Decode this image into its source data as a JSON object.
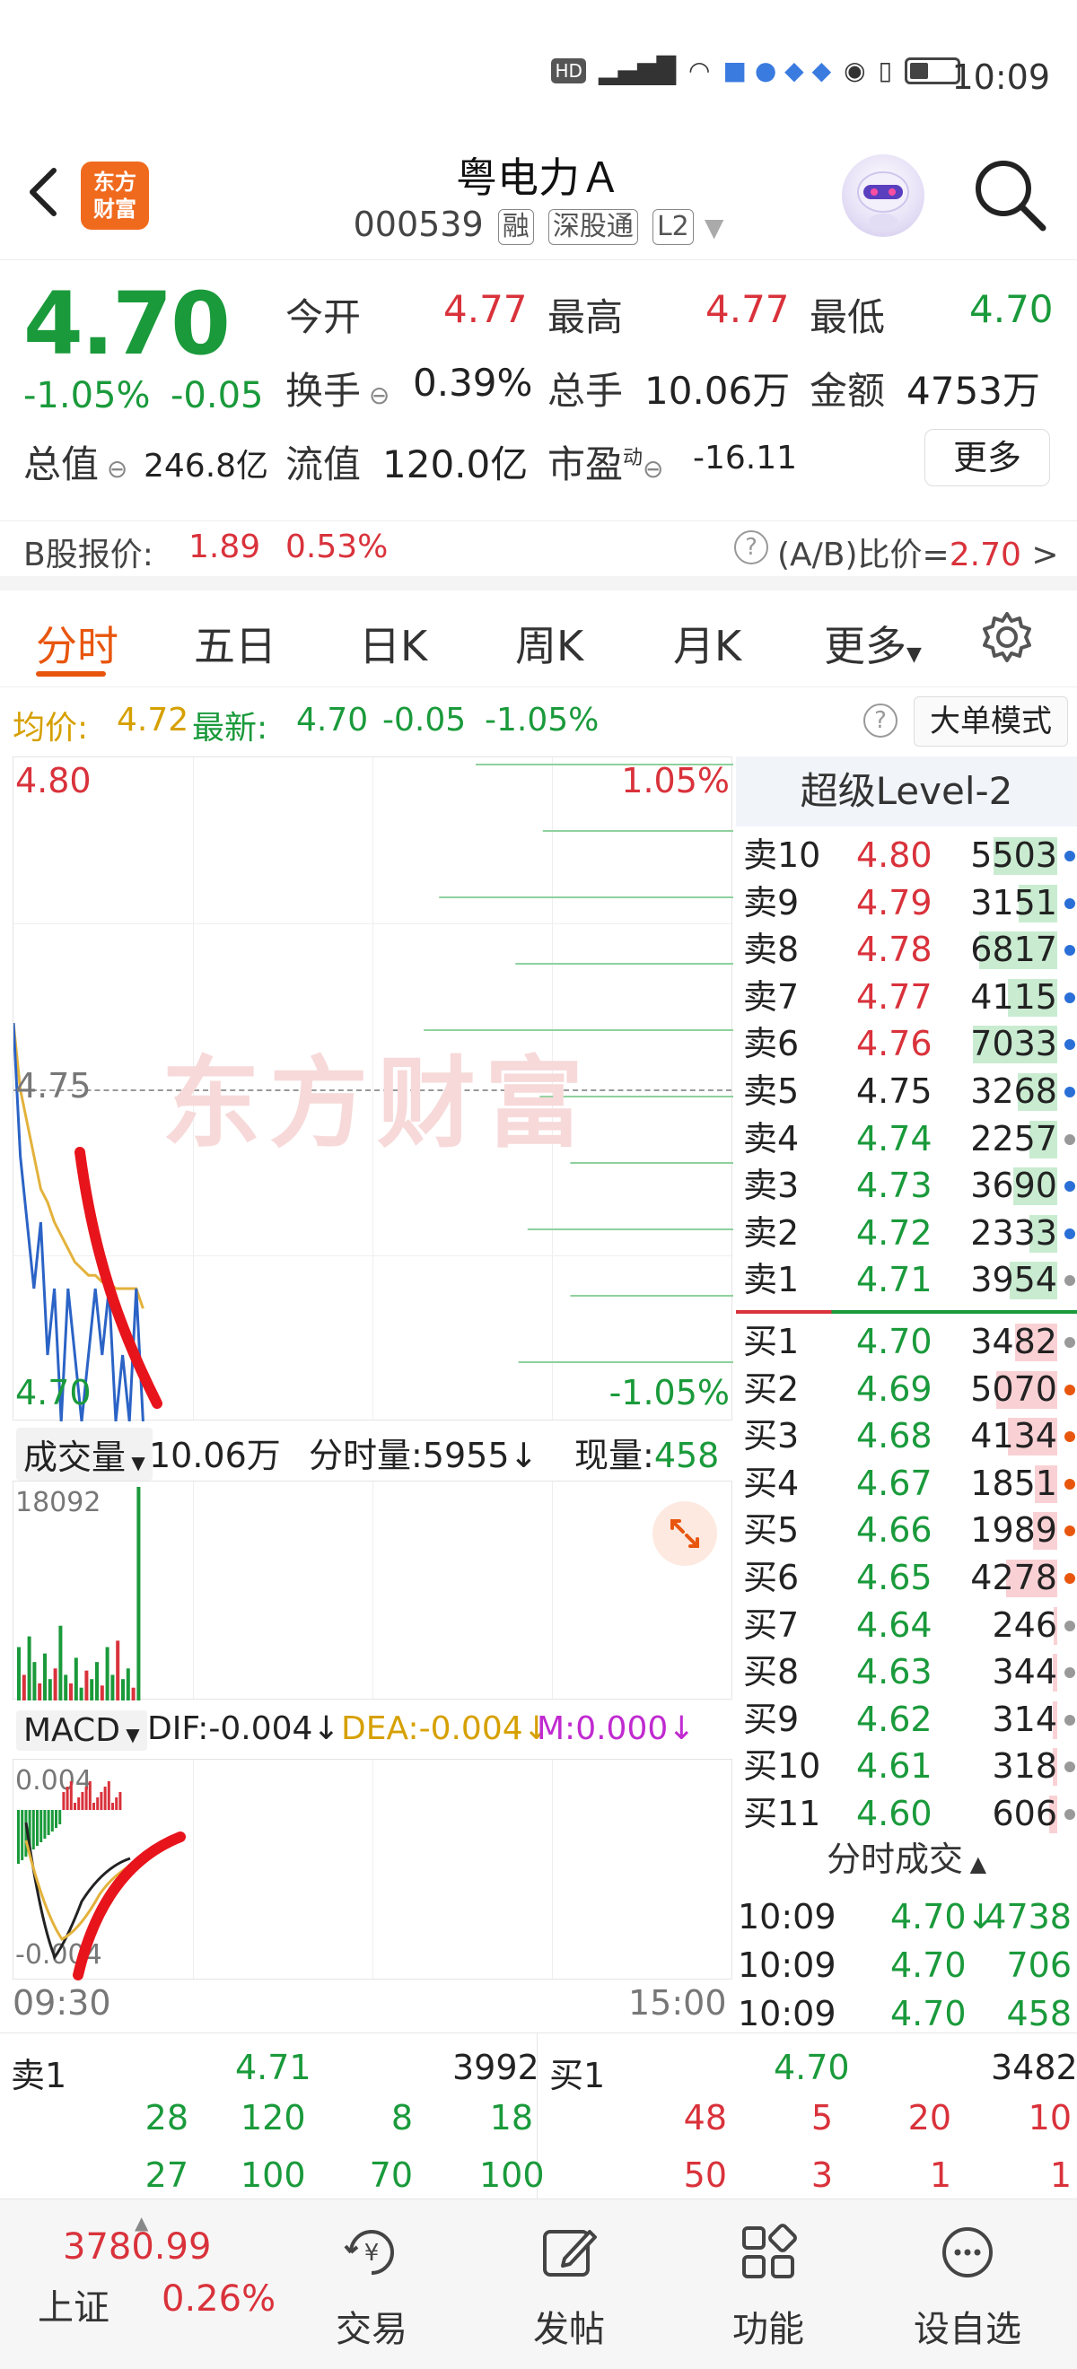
{
  "status": {
    "time": "10:09",
    "icons": [
      "HD",
      "4G",
      "signal",
      "wifi",
      "battery"
    ]
  },
  "header": {
    "logo_text_1": "东方",
    "logo_text_2": "财富",
    "name": "粤电力Ａ",
    "code": "000539",
    "tag_margin": "融",
    "tag_connect": "深股通",
    "tag_level": "L2"
  },
  "quote": {
    "price": "4.70",
    "change_pct": "-1.05%",
    "change": "-0.05",
    "open_label": "今开",
    "open": "4.77",
    "high_label": "最高",
    "high": "4.77",
    "low_label": "最低",
    "low": "4.70",
    "turnover_label": "换手",
    "turnover": "0.39%",
    "volume_label": "总手",
    "volume": "10.06万",
    "amount_label": "金额",
    "amount": "4753万",
    "mktcap_label": "总值",
    "mktcap": "246.8亿",
    "float_label": "流值",
    "float": "120.0亿",
    "pe_label": "市盈",
    "pe_sup": "动",
    "pe": "-16.11",
    "more": "更多"
  },
  "bshare": {
    "label": "B股报价:",
    "price": "1.89",
    "pct": "0.53%",
    "ratio_label": "(A/B)比价=",
    "ratio": "2.70",
    "arrow": ">"
  },
  "tabs": [
    "分时",
    "五日",
    "日K",
    "周K",
    "月K",
    "更多"
  ],
  "info": {
    "avg_label": "均价:",
    "avg": "4.72",
    "latest_label": "最新:",
    "latest": "4.70",
    "latest_chg": "-0.05",
    "latest_pct": "-1.05%",
    "help": "?",
    "big_mode": "大单模式"
  },
  "chart": {
    "top_price": "4.80",
    "top_pct": "1.05%",
    "mid_price": "4.75",
    "bottom_price": "4.70",
    "bottom_pct": "-1.05%",
    "watermark": "东方财富"
  },
  "chart_data": {
    "type": "line",
    "series": [
      {
        "name": "price",
        "values": [
          4.76,
          4.74,
          4.73,
          4.72,
          4.73,
          4.71,
          4.72,
          4.7,
          4.72,
          4.71,
          4.7,
          4.71,
          4.72,
          4.71,
          4.72,
          4.7,
          4.71,
          4.7,
          4.72,
          4.7
        ]
      },
      {
        "name": "avg",
        "values": [
          4.76,
          4.75,
          4.745,
          4.74,
          4.735,
          4.733,
          4.73,
          4.728,
          4.726,
          4.724,
          4.723,
          4.722,
          4.722,
          4.721,
          4.721,
          4.72,
          4.72,
          4.72,
          4.72,
          4.717
        ]
      }
    ],
    "ylim": [
      4.7,
      4.8
    ]
  },
  "volume": {
    "selector": "成交量",
    "total": "10.06万",
    "tick_label": "分时量:5955↓",
    "now_label": "现量:",
    "now": "458",
    "max": "18092",
    "bars": [
      0.25,
      0.12,
      0.3,
      0.18,
      0.08,
      0.22,
      0.1,
      0.15,
      0.35,
      0.12,
      0.08,
      0.2,
      0.06,
      0.14,
      0.1,
      0.18,
      0.07,
      0.25,
      0.12,
      0.28,
      0.1,
      0.15,
      0.06,
      1.0
    ]
  },
  "macd": {
    "selector": "MACD",
    "dif": "DIF:-0.004↓",
    "dea": "DEA:-0.004↓",
    "m": "M:0.000↓",
    "top_label": "0.004",
    "bottom_label": "-0.004"
  },
  "times": {
    "start": "09:30",
    "end": "15:00"
  },
  "level2": {
    "title": "超级Level-2",
    "asks": [
      {
        "label": "卖10",
        "price": "4.80",
        "qty": "5503",
        "bar": 0.55,
        "pcolor": "#d9323b",
        "dot": "#2a6fd6"
      },
      {
        "label": "卖9",
        "price": "4.79",
        "qty": "3151",
        "bar": 0.33,
        "pcolor": "#d9323b",
        "dot": "#2a6fd6"
      },
      {
        "label": "卖8",
        "price": "4.78",
        "qty": "6817",
        "bar": 0.67,
        "pcolor": "#d9323b",
        "dot": "#2a6fd6"
      },
      {
        "label": "卖7",
        "price": "4.77",
        "qty": "4115",
        "bar": 0.42,
        "pcolor": "#d9323b",
        "dot": "#2a6fd6"
      },
      {
        "label": "卖6",
        "price": "4.76",
        "qty": "7033",
        "bar": 0.72,
        "pcolor": "#d9323b",
        "dot": "#2a6fd6"
      },
      {
        "label": "卖5",
        "price": "4.75",
        "qty": "3268",
        "bar": 0.34,
        "pcolor": "#222222",
        "dot": "#2a6fd6"
      },
      {
        "label": "卖4",
        "price": "4.74",
        "qty": "2257",
        "bar": 0.24,
        "pcolor": "#1a9a3b",
        "dot": "#999999"
      },
      {
        "label": "卖3",
        "price": "4.73",
        "qty": "3690",
        "bar": 0.38,
        "pcolor": "#1a9a3b",
        "dot": "#2a6fd6"
      },
      {
        "label": "卖2",
        "price": "4.72",
        "qty": "2333",
        "bar": 0.24,
        "pcolor": "#1a9a3b",
        "dot": "#2a6fd6"
      },
      {
        "label": "卖1",
        "price": "4.71",
        "qty": "3954",
        "bar": 0.41,
        "pcolor": "#1a9a3b",
        "dot": "#999999"
      }
    ],
    "bids": [
      {
        "label": "买1",
        "price": "4.70",
        "qty": "3482",
        "bar": 0.36,
        "dot": "#999999"
      },
      {
        "label": "买2",
        "price": "4.69",
        "qty": "5070",
        "bar": 0.52,
        "dot": "#e8560e"
      },
      {
        "label": "买3",
        "price": "4.68",
        "qty": "4134",
        "bar": 0.42,
        "dot": "#e8560e"
      },
      {
        "label": "买4",
        "price": "4.67",
        "qty": "1851",
        "bar": 0.19,
        "dot": "#e8560e"
      },
      {
        "label": "买5",
        "price": "4.66",
        "qty": "1989",
        "bar": 0.21,
        "dot": "#e8560e"
      },
      {
        "label": "买6",
        "price": "4.65",
        "qty": "4278",
        "bar": 0.44,
        "dot": "#e8560e"
      },
      {
        "label": "买7",
        "price": "4.64",
        "qty": "246",
        "bar": 0.03,
        "dot": "#999999"
      },
      {
        "label": "买8",
        "price": "4.63",
        "qty": "344",
        "bar": 0.04,
        "dot": "#999999"
      },
      {
        "label": "买9",
        "price": "4.62",
        "qty": "314",
        "bar": 0.04,
        "dot": "#999999"
      },
      {
        "label": "买10",
        "price": "4.61",
        "qty": "318",
        "bar": 0.04,
        "dot": "#999999"
      },
      {
        "label": "买11",
        "price": "4.60",
        "qty": "606",
        "bar": 0.07,
        "dot": "#999999"
      }
    ],
    "ticks_title": "分时成交",
    "ticks": [
      {
        "time": "10:09",
        "price": "4.70",
        "qty": "4738",
        "arrow": "↓"
      },
      {
        "time": "10:09",
        "price": "4.70",
        "qty": "706",
        "arrow": ""
      },
      {
        "time": "10:09",
        "price": "4.70",
        "qty": "458",
        "arrow": ""
      }
    ]
  },
  "orderbook": {
    "ask_label": "卖1",
    "ask_price": "4.71",
    "ask_qty": "3992",
    "bid_label": "买1",
    "bid_price": "4.70",
    "bid_qty": "3482",
    "ask_q1": [
      "28",
      "120",
      "8",
      "18"
    ],
    "ask_q2": [
      "27",
      "100",
      "70",
      "100"
    ],
    "bid_q1": [
      "48",
      "5",
      "20",
      "10"
    ],
    "bid_q2": [
      "50",
      "3",
      "1",
      "1"
    ]
  },
  "nav": {
    "index_value": "3780.99",
    "index_name": "上证",
    "index_pct": "0.26%",
    "trade": "交易",
    "post": "发帖",
    "func": "功能",
    "watch": "设自选"
  }
}
